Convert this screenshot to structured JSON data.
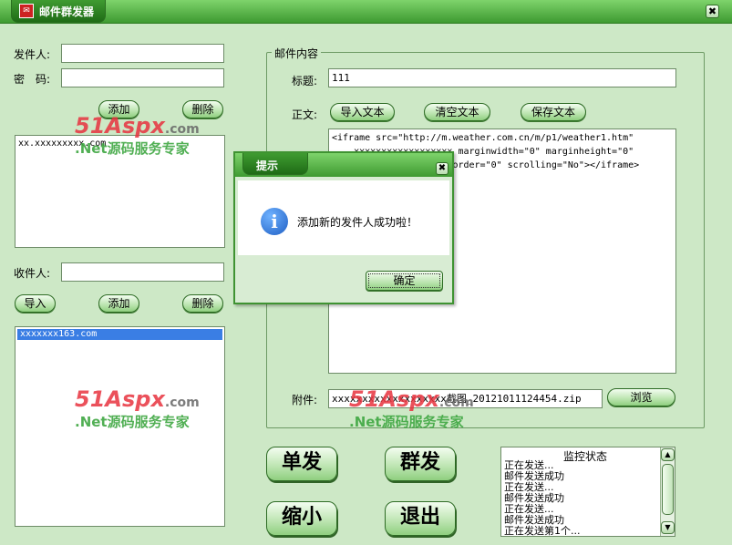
{
  "window": {
    "title": "邮件群发器",
    "close_glyph": "✖"
  },
  "sender": {
    "sender_label": "发件人:",
    "password_label": "密　码:",
    "add_label": "添加",
    "delete_label": "删除",
    "list": [
      "xx.xxxxxxxxx.com"
    ]
  },
  "recipient": {
    "label": "收件人:",
    "import_label": "导入",
    "add_label": "添加",
    "delete_label": "删除",
    "list": [
      "xxxxxxx163.com"
    ]
  },
  "mail": {
    "group_title": "邮件内容",
    "subject_label": "标题:",
    "subject_value": "111",
    "body_label": "正文:",
    "import_text_label": "导入文本",
    "clear_text_label": "清空文本",
    "save_text_label": "保存文本",
    "body_text": "<iframe src=\"http://m.weather.com.cn/m/p1/weather1.htm\"\n    xxxxxxxxxxxxxxxxxx marginwidth=\"0\" marginheight=\"0\"\n    xxxxxxxxxxx frameborder=\"0\" scrolling=\"No\"></iframe>",
    "attachment_label": "附件:",
    "attachment_value": "xxxxxxxxxxxxxxxxxxx截图_20121011124454.zip",
    "browse_label": "浏览"
  },
  "actions": {
    "single_send": "单发",
    "group_send": "群发",
    "minimize": "缩小",
    "exit": "退出"
  },
  "monitor": {
    "title": "监控状态",
    "lines": [
      "正在发送...",
      "邮件发送成功",
      "正在发送...",
      "邮件发送成功",
      "正在发送...",
      "邮件发送成功",
      "正在发送第1个..."
    ]
  },
  "dialog": {
    "title": "提示",
    "message": "添加新的发件人成功啦！",
    "ok_label": "确定",
    "icon": "info-icon"
  },
  "watermark": {
    "brand": "51Aspx",
    "domain": ".com",
    "slogan": ".Net源码服务专家"
  },
  "colors": {
    "accent": "#3e9a31",
    "background": "#cde8c6",
    "selection": "#3a7ee4"
  }
}
